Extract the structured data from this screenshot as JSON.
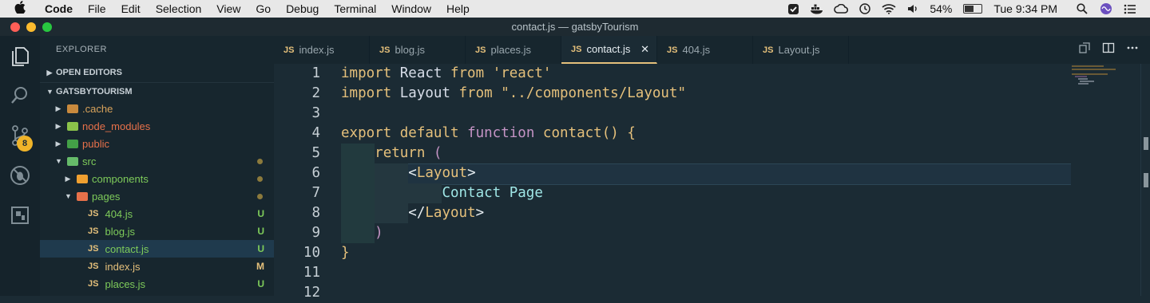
{
  "menubar": {
    "app": "Code",
    "items": [
      "File",
      "Edit",
      "Selection",
      "View",
      "Go",
      "Debug",
      "Terminal",
      "Window",
      "Help"
    ],
    "battery": "54%",
    "battery_level": 0.54,
    "clock": "Tue 9:34 PM"
  },
  "window": {
    "title": "contact.js — gatsbyTourism"
  },
  "activity_bar": {
    "scm_badge": "8"
  },
  "sidebar": {
    "title": "EXPLORER",
    "open_editors": "OPEN EDITORS",
    "project": "GATSBYTOURISM",
    "tree": [
      {
        "label": ".cache",
        "type": "folder",
        "color": "#e5a94f",
        "status": ""
      },
      {
        "label": "node_modules",
        "type": "folder",
        "color": "#8bc34a",
        "status": ""
      },
      {
        "label": "public",
        "type": "folder",
        "color": "#4caf50",
        "status": ""
      },
      {
        "label": "src",
        "type": "folder",
        "color": "#66bb6a",
        "status": ""
      },
      {
        "label": "components",
        "type": "folder",
        "color": "#f0a030",
        "status": ""
      },
      {
        "label": "pages",
        "type": "folder",
        "color": "#e8714a",
        "status": ""
      },
      {
        "label": "404.js",
        "type": "file",
        "status": "U"
      },
      {
        "label": "blog.js",
        "type": "file",
        "status": "U"
      },
      {
        "label": "contact.js",
        "type": "file",
        "status": "U"
      },
      {
        "label": "index.js",
        "type": "file",
        "status": "M"
      },
      {
        "label": "places.js",
        "type": "file",
        "status": "U"
      }
    ],
    "file_icon_label": "JS"
  },
  "tabs": [
    {
      "label": "index.js",
      "active": false
    },
    {
      "label": "blog.js",
      "active": false
    },
    {
      "label": "places.js",
      "active": false
    },
    {
      "label": "contact.js",
      "active": true
    },
    {
      "label": "404.js",
      "active": false
    },
    {
      "label": "Layout.js",
      "active": false
    }
  ],
  "editor": {
    "line_numbers": [
      "1",
      "2",
      "3",
      "4",
      "5",
      "6",
      "7",
      "8",
      "9",
      "10",
      "11",
      "12"
    ],
    "lines": [
      "import React from 'react'",
      "import Layout from \"../components/Layout\"",
      "",
      "export default function contact() {",
      "    return (",
      "        <Layout>",
      "            Contact Page",
      "        </Layout>",
      "    )",
      "}",
      "",
      ""
    ]
  },
  "colors": {
    "accent": "#e5c07b",
    "untracked": "#7ecb5a",
    "modified": "#e5c07b"
  }
}
